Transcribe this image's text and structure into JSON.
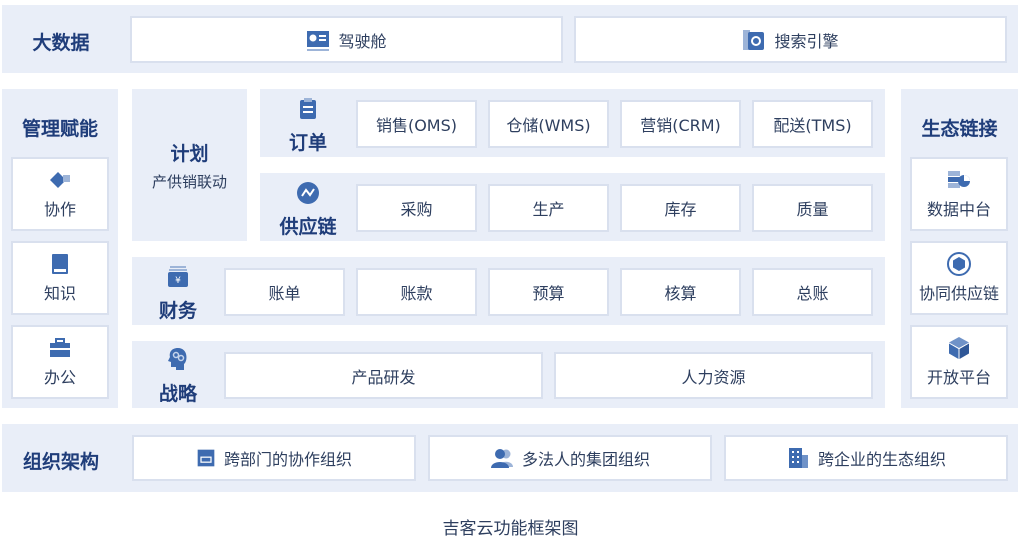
{
  "bigdata": {
    "title": "大数据",
    "items": [
      "驾驶舱",
      "搜索引擎"
    ]
  },
  "mgmt": {
    "title": "管理赋能",
    "items": [
      "协作",
      "知识",
      "办公"
    ]
  },
  "plan": {
    "title": "计划",
    "subtitle": "产供销联动"
  },
  "order": {
    "title": "订单",
    "items": [
      "销售(OMS)",
      "仓储(WMS)",
      "营销(CRM)",
      "配送(TMS)"
    ]
  },
  "supply": {
    "title": "供应链",
    "items": [
      "采购",
      "生产",
      "库存",
      "质量"
    ]
  },
  "finance": {
    "title": "财务",
    "items": [
      "账单",
      "账款",
      "预算",
      "核算",
      "总账"
    ]
  },
  "strategy": {
    "title": "战略",
    "items": [
      "产品研发",
      "人力资源"
    ]
  },
  "eco": {
    "title": "生态链接",
    "items": [
      "数据中台",
      "协同供应链",
      "开放平台"
    ]
  },
  "org": {
    "title": "组织架构",
    "items": [
      "跨部门的协作组织",
      "多法人的集团组织",
      "跨企业的生态组织"
    ]
  },
  "caption": "吉客云功能框架图",
  "colors": {
    "panel": "#e9eef8",
    "heading": "#1f3d7a",
    "icon": "#3e6bb0"
  }
}
